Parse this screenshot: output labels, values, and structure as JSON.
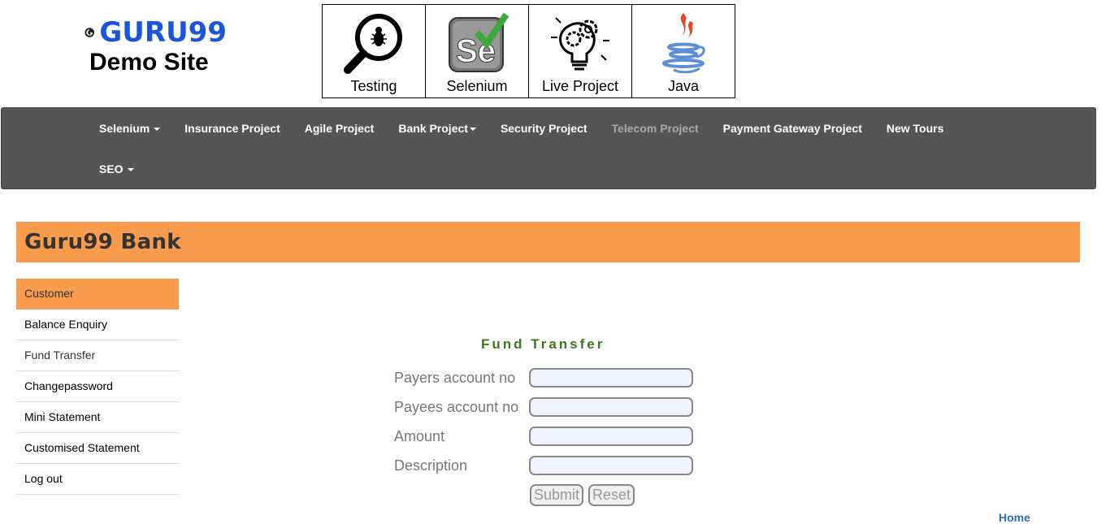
{
  "logo": {
    "brand": "GURU99",
    "subtitle": "Demo Site"
  },
  "tiles": [
    {
      "label": "Testing",
      "icon": "magnifier-bug-icon"
    },
    {
      "label": "Selenium",
      "icon": "selenium-icon"
    },
    {
      "label": "Live Project",
      "icon": "lightbulb-gears-icon"
    },
    {
      "label": "Java",
      "icon": "java-cup-icon"
    }
  ],
  "nav": {
    "row1": [
      "Selenium",
      "Insurance Project",
      "Agile Project",
      "Bank Project",
      "Security Project",
      "Telecom Project",
      "Payment Gateway Project",
      "New Tours"
    ],
    "row2": [
      "SEO"
    ]
  },
  "banner": {
    "title": "Guru99 Bank"
  },
  "menu": [
    "Customer",
    "Balance Enquiry",
    "Fund Transfer",
    "Changepassword",
    "Mini Statement",
    "Customised Statement",
    "Log out"
  ],
  "form": {
    "title": "Fund Transfer",
    "fields": [
      {
        "label": "Payers account no",
        "value": ""
      },
      {
        "label": "Payees account no",
        "value": ""
      },
      {
        "label": "Amount",
        "value": ""
      },
      {
        "label": "Description",
        "value": ""
      }
    ],
    "submit_label": "Submit",
    "reset_label": "Reset"
  },
  "footer": {
    "home_link": "Home"
  },
  "colors": {
    "accent": "#f89b4c",
    "navbar": "#555555",
    "form_title": "#3a7a1a",
    "link": "#2a6ebd",
    "brand": "#1a56db"
  }
}
